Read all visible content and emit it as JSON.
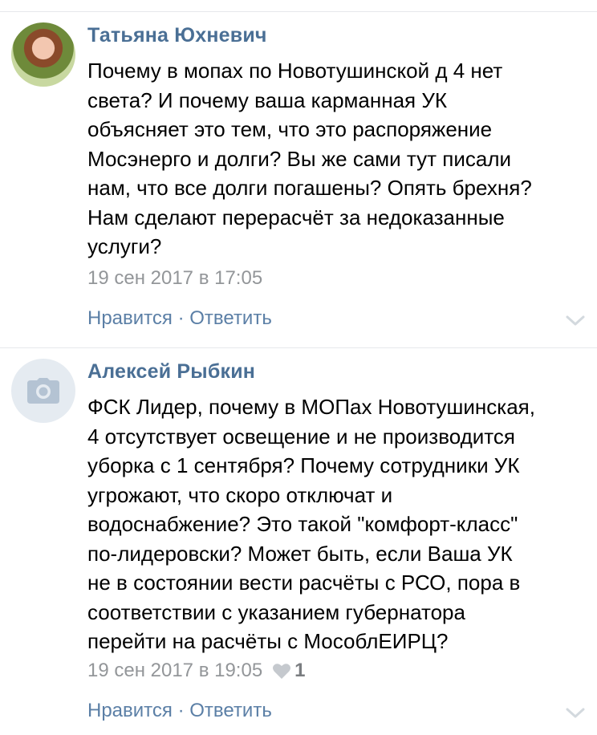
{
  "comments": [
    {
      "author": "Татьяна Юхневич",
      "text": "Почему в мопах по Новотушинской д 4 нет\nсвета? И почему ваша карманная УК\nобъясняет это тем, что это распоряжение\nМосэнерго и долги? Вы же сами тут писали\nнам, что все долги погашены? Опять брехня?\nНам сделают перерасчёт за недоказанные\nуслуги?",
      "date": "19 сен 2017 в 17:05",
      "actions": {
        "like": "Нравится",
        "separator": "·",
        "reply": "Ответить"
      }
    },
    {
      "author": "Алексей Рыбкин",
      "text": "ФСК Лидер, почему в МОПах Новотушинская,\n4 отсутствует освещение и не производится\nуборка с 1 сентября? Почему сотрудники УК\nугрожают, что скоро отключат и\nводоснабжение? Это такой \"комфорт-класс\"\nпо-лидеровски? Может быть, если Ваша УК\nне в состоянии вести расчёты с РСО, пора в\nсоответствии с указанием губернатора\nперейти на расчёты с МособлЕИРЦ?",
      "date": "19 сен 2017 в 19:05",
      "likes": "1",
      "actions": {
        "like": "Нравится",
        "separator": "·",
        "reply": "Ответить"
      }
    }
  ],
  "icons": {
    "camera": "camera-icon",
    "heart": "heart-icon",
    "chevron": "chevron-down-icon"
  },
  "colors": {
    "author": "#4a6f95",
    "action": "#5b7fa6",
    "meta": "#939699",
    "separator": "#e7e8ec"
  }
}
